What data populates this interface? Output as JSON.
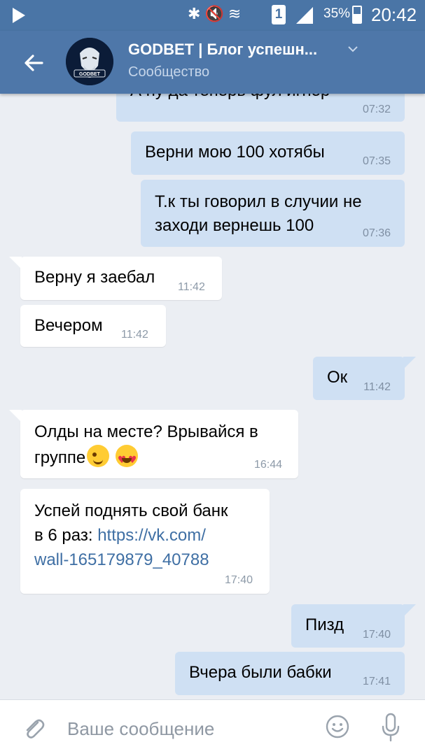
{
  "status_bar": {
    "icons": [
      "play-icon",
      "bluetooth-icon",
      "mute-icon",
      "wifi-icon",
      "sim-icon",
      "signal-icon",
      "battery-icon"
    ],
    "sim_slot": "1",
    "battery": "35%",
    "time": "20:42"
  },
  "header": {
    "title": "GODBET | Блог успешн...",
    "subtitle": "Сообщество",
    "avatar_text": "GODBET"
  },
  "messages": [
    {
      "dir": "out",
      "text": "А ну да теперь фул игнор",
      "time": "07:32"
    },
    {
      "dir": "out",
      "text": "Верни мою 100 хотябы",
      "time": "07:35"
    },
    {
      "dir": "out",
      "line1": "Т.к ты говорил в случии не",
      "line2": "заходи вернешь 100",
      "time": "07:36"
    },
    {
      "dir": "in",
      "text": "Верну я заебал",
      "time": "11:42"
    },
    {
      "dir": "in",
      "text": "Вечером",
      "time": "11:42"
    },
    {
      "dir": "out",
      "text": "Ок",
      "time": "11:42"
    },
    {
      "dir": "in",
      "line1": "Олды на месте? Врывайся в",
      "line2": "группе",
      "emoji": [
        "wink-emoji",
        "heart-eyes-emoji"
      ],
      "time": "16:44"
    },
    {
      "dir": "in",
      "line1": "Успей поднять свой банк",
      "line2_prefix": "в 6 раз: ",
      "link_part1": "https://vk.com/",
      "link_part2": "wall-165179879_40788",
      "time": "17:40"
    },
    {
      "dir": "out",
      "text": "Пизд",
      "time": "17:40"
    },
    {
      "dir": "out",
      "text": "Вчера были бабки",
      "time": "17:41"
    }
  ],
  "input": {
    "placeholder": "Ваше сообщение"
  },
  "colors": {
    "header": "#4e77a9",
    "status_bar": "#4a75a6",
    "background": "#ebeef3",
    "outgoing_bubble": "#cfe0f3",
    "incoming_bubble": "#ffffff",
    "link": "#3f6fa4"
  }
}
